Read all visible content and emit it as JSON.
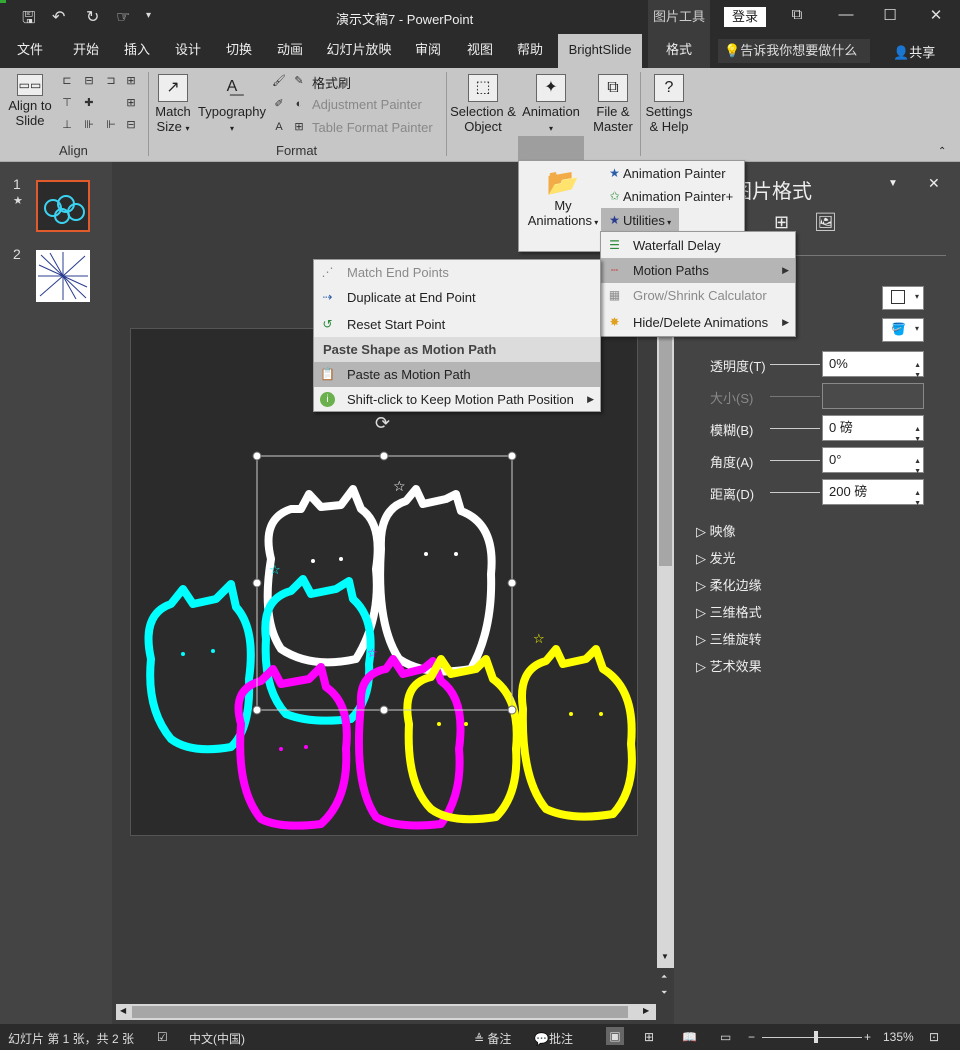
{
  "titlebar": {
    "title": "演示文稿7  -  PowerPoint",
    "picture_tools": "图片工具",
    "login": "登录"
  },
  "tabs": [
    "文件",
    "开始",
    "插入",
    "设计",
    "切换",
    "动画",
    "幻灯片放映",
    "审阅",
    "视图",
    "帮助",
    "BrightSlide",
    "格式"
  ],
  "tellme": "告诉我你想要做什么",
  "share": "共享",
  "ribbon": {
    "align_to_slide": "Align to\nSlide",
    "align_label": "Align",
    "match_size": "Match\nSize",
    "typography": "Typography",
    "format_painter": "格式刷",
    "adjustment_painter": "Adjustment Painter",
    "table_format_painter": "Table Format Painter",
    "format_label": "Format",
    "selection_object": "Selection &\nObject",
    "animation": "Animation",
    "file_master": "File &\nMaster",
    "settings_help": "Settings\n& Help"
  },
  "anim_menu": {
    "my_animations": "My\nAnimations",
    "animation_painter": "Animation Painter",
    "animation_painter_plus": "Animation Painter+",
    "utilities": "Utilities"
  },
  "utilities_menu": {
    "waterfall_delay": "Waterfall Delay",
    "motion_paths": "Motion Paths",
    "grow_shrink": "Grow/Shrink Calculator",
    "hide_delete": "Hide/Delete Animations"
  },
  "motion_menu": {
    "match_end": "Match End Points",
    "duplicate_end": "Duplicate at End Point",
    "reset_start": "Reset Start Point",
    "paste_header": "Paste Shape as Motion Path",
    "paste_as": "Paste as Motion Path",
    "shift_click": "Shift-click to Keep Motion Path Position"
  },
  "thumbs": {
    "n1": "1",
    "n2": "2",
    "star": "★"
  },
  "pane": {
    "title": "图片格式",
    "transparency": "透明度(T)",
    "transparency_val": "0%",
    "size": "大小(S)",
    "blur": "模糊(B)",
    "blur_val": "0 磅",
    "angle": "角度(A)",
    "angle_val": "0°",
    "distance": "距离(D)",
    "distance_val": "200 磅",
    "sections": [
      "映像",
      "发光",
      "柔化边缘",
      "三维格式",
      "三维旋转",
      "艺术效果"
    ]
  },
  "status": {
    "slide_info": "幻灯片 第 1 张，共 2 张",
    "language": "中文(中国)",
    "notes": "备注",
    "comments": "批注",
    "zoom": "135%"
  },
  "colors": {
    "cyan": "#00ffff",
    "magenta": "#ff00ff",
    "yellow": "#ffff00",
    "white": "#ffffff"
  }
}
